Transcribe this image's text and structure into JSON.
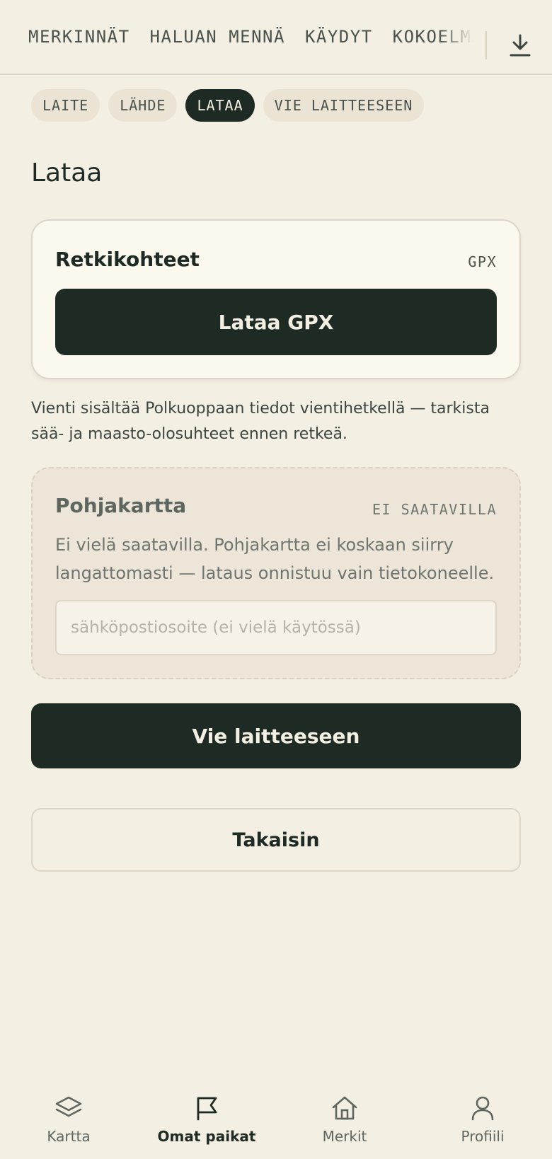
{
  "top_tabs": [
    "MERKINNÄT",
    "HALUAN MENNÄ",
    "KÄYDYT",
    "KOKOELMAT"
  ],
  "steps": {
    "items": [
      "LAITE",
      "LÄHDE",
      "LATAA",
      "VIE LAITTEESEEN"
    ],
    "active": "LATAA"
  },
  "page": {
    "title": "Lataa"
  },
  "waypoints_card": {
    "title": "Retkikohteet",
    "badge": "GPX",
    "button": "Lataa GPX"
  },
  "note": "Vienti sisältää Polkuoppaan tiedot vientihetkellä — tarkista sää- ja maasto-olosuhteet ennen retkeä.",
  "basemap_card": {
    "title": "Pohjakartta",
    "badge": "EI SAATAVILLA",
    "description": "Ei vielä saatavilla. Pohjakartta ei koskaan siirry langattomasti — lataus onnistuu vain tietokoneelle.",
    "email_placeholder": "sähköpostiosoite (ei vielä käytössä)"
  },
  "actions": {
    "export": "Vie laitteeseen",
    "back": "Takaisin"
  },
  "bottom_nav": {
    "items": [
      {
        "label": "Kartta",
        "icon": "layers-icon"
      },
      {
        "label": "Omat paikat",
        "icon": "flag-icon"
      },
      {
        "label": "Merkit",
        "icon": "home-icon"
      },
      {
        "label": "Profiili",
        "icon": "user-icon"
      }
    ],
    "active": "Omat paikat"
  },
  "colors": {
    "background": "#f4efe3",
    "dark": "#1e2a24",
    "card": "#fbf8ee",
    "chip": "#ebe4d4",
    "border": "#ddd6c6"
  }
}
